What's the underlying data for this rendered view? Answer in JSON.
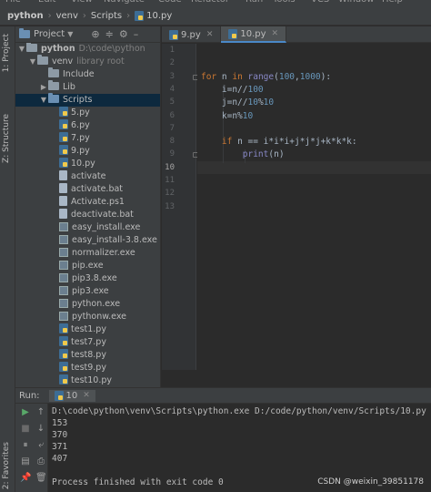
{
  "menubar": {
    "items": [
      "File",
      "Edit",
      "View",
      "Navigate",
      "Code",
      "Refactor",
      "Run",
      "Tools",
      "VCS",
      "Window",
      "Help"
    ]
  },
  "breadcrumb": [
    "python",
    "venv",
    "Scripts",
    "10.py"
  ],
  "side_tabs": {
    "project": "1: Project",
    "structure": "Z: Structure",
    "favorites": "2: Favorites"
  },
  "project_panel": {
    "title": "Project",
    "tree": [
      {
        "label": "python",
        "note": "D:\\code\\python",
        "level": 0,
        "arrow": "▼",
        "icon": "folder"
      },
      {
        "label": "venv",
        "note": "library root",
        "level": 1,
        "arrow": "▼",
        "icon": "folder"
      },
      {
        "label": "Include",
        "note": "",
        "level": 2,
        "arrow": "",
        "icon": "folder"
      },
      {
        "label": "Lib",
        "note": "",
        "level": 2,
        "arrow": "▶",
        "icon": "folder"
      },
      {
        "label": "Scripts",
        "note": "",
        "level": 2,
        "arrow": "▼",
        "icon": "folder-blue",
        "selected": true
      },
      {
        "label": "5.py",
        "note": "",
        "level": 3,
        "arrow": "",
        "icon": "py"
      },
      {
        "label": "6.py",
        "note": "",
        "level": 3,
        "arrow": "",
        "icon": "py"
      },
      {
        "label": "7.py",
        "note": "",
        "level": 3,
        "arrow": "",
        "icon": "py"
      },
      {
        "label": "9.py",
        "note": "",
        "level": 3,
        "arrow": "",
        "icon": "py"
      },
      {
        "label": "10.py",
        "note": "",
        "level": 3,
        "arrow": "",
        "icon": "py"
      },
      {
        "label": "activate",
        "note": "",
        "level": 3,
        "arrow": "",
        "icon": "plain"
      },
      {
        "label": "activate.bat",
        "note": "",
        "level": 3,
        "arrow": "",
        "icon": "plain"
      },
      {
        "label": "Activate.ps1",
        "note": "",
        "level": 3,
        "arrow": "",
        "icon": "plain"
      },
      {
        "label": "deactivate.bat",
        "note": "",
        "level": 3,
        "arrow": "",
        "icon": "plain"
      },
      {
        "label": "easy_install.exe",
        "note": "",
        "level": 3,
        "arrow": "",
        "icon": "exe"
      },
      {
        "label": "easy_install-3.8.exe",
        "note": "",
        "level": 3,
        "arrow": "",
        "icon": "exe"
      },
      {
        "label": "normalizer.exe",
        "note": "",
        "level": 3,
        "arrow": "",
        "icon": "exe"
      },
      {
        "label": "pip.exe",
        "note": "",
        "level": 3,
        "arrow": "",
        "icon": "exe"
      },
      {
        "label": "pip3.8.exe",
        "note": "",
        "level": 3,
        "arrow": "",
        "icon": "exe"
      },
      {
        "label": "pip3.exe",
        "note": "",
        "level": 3,
        "arrow": "",
        "icon": "exe"
      },
      {
        "label": "python.exe",
        "note": "",
        "level": 3,
        "arrow": "",
        "icon": "exe"
      },
      {
        "label": "pythonw.exe",
        "note": "",
        "level": 3,
        "arrow": "",
        "icon": "exe"
      },
      {
        "label": "test1.py",
        "note": "",
        "level": 3,
        "arrow": "",
        "icon": "py"
      },
      {
        "label": "test7.py",
        "note": "",
        "level": 3,
        "arrow": "",
        "icon": "py"
      },
      {
        "label": "test8.py",
        "note": "",
        "level": 3,
        "arrow": "",
        "icon": "py"
      },
      {
        "label": "test9.py",
        "note": "",
        "level": 3,
        "arrow": "",
        "icon": "py"
      },
      {
        "label": "test10.py",
        "note": "",
        "level": 3,
        "arrow": "",
        "icon": "py"
      }
    ]
  },
  "editor": {
    "tabs": [
      {
        "label": "9.py",
        "active": false
      },
      {
        "label": "10.py",
        "active": true
      }
    ],
    "line_numbers": [
      "1",
      "2",
      "3",
      "4",
      "5",
      "6",
      "7",
      "8",
      "9",
      "10",
      "11",
      "12",
      "13"
    ],
    "caret_line": 10,
    "lines": [
      [],
      [],
      [
        {
          "t": "for ",
          "c": "kw"
        },
        {
          "t": "n "
        },
        {
          "t": "in ",
          "c": "kw"
        },
        {
          "t": "range",
          "c": "bi"
        },
        {
          "t": "("
        },
        {
          "t": "100",
          "c": "num"
        },
        {
          "t": ","
        },
        {
          "t": "1000",
          "c": "num"
        },
        {
          "t": "):"
        }
      ],
      [
        {
          "t": "    i=n//"
        },
        {
          "t": "100",
          "c": "num"
        }
      ],
      [
        {
          "t": "    j=n//"
        },
        {
          "t": "10",
          "c": "num"
        },
        {
          "t": "%"
        },
        {
          "t": "10",
          "c": "num"
        }
      ],
      [
        {
          "t": "    k=n%"
        },
        {
          "t": "10",
          "c": "num"
        }
      ],
      [],
      [
        {
          "t": "    "
        },
        {
          "t": "if ",
          "c": "kw"
        },
        {
          "t": "n == i*i*i+j*j*j+k*k*k:"
        }
      ],
      [
        {
          "t": "        "
        },
        {
          "t": "print",
          "c": "bi"
        },
        {
          "t": "(n)"
        }
      ],
      [],
      [],
      [],
      []
    ]
  },
  "run_panel": {
    "label": "Run:",
    "tab": "10",
    "output": [
      "D:\\code\\python\\venv\\Scripts\\python.exe D:/code/python/venv/Scripts/10.py",
      "153",
      "370",
      "371",
      "407",
      "",
      "Process finished with exit code 0"
    ]
  },
  "watermark": "CSDN @weixin_39851178",
  "colors": {
    "keyword": "#cc7832",
    "number": "#6897bb",
    "builtin": "#8888c6",
    "text": "#a9b7c6",
    "selection": "#0d293e",
    "panel": "#3c3f41",
    "editor": "#2b2b2b"
  }
}
